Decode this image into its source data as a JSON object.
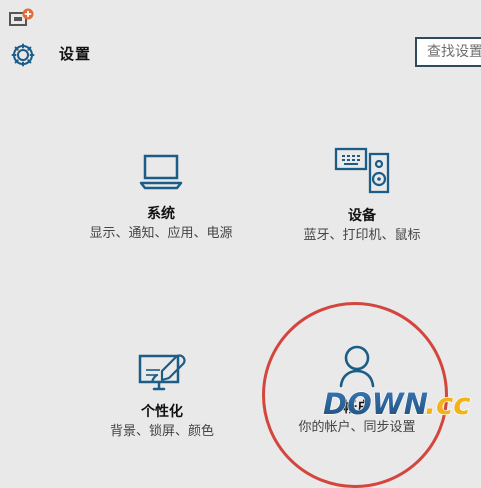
{
  "app": {
    "title": "设置"
  },
  "search": {
    "placeholder": "查找设置"
  },
  "tiles": [
    {
      "title": "系统",
      "description": "显示、通知、应用、电源",
      "icon": "laptop-icon"
    },
    {
      "title": "设备",
      "description": "蓝牙、打印机、鼠标",
      "icon": "devices-icon"
    },
    {
      "title": "个性化",
      "description": "背景、锁屏、颜色",
      "icon": "personalization-icon"
    },
    {
      "title": "帐户",
      "description": "你的帐户、同步设置",
      "icon": "account-icon"
    }
  ],
  "watermark": {
    "text": "DOWN.cc"
  },
  "colors": {
    "background": "#e9e9e9",
    "accent": "#1b5d86",
    "annotation": "#d3463e",
    "watermark_main": "#245a86",
    "watermark_secondary": "#f3b11a"
  }
}
